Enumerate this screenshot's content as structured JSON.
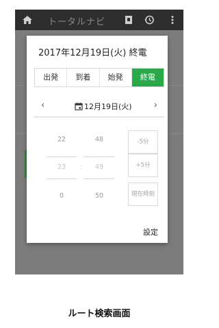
{
  "appbar": {
    "title": "トータルナビ"
  },
  "dialog": {
    "title": "2017年12月19日(火) 終電",
    "modes": [
      "出発",
      "到着",
      "始発",
      "終電"
    ],
    "active_mode": "終電",
    "date": "12月19日(火)",
    "prev": "‹",
    "next": "›",
    "hour_values": [
      "22",
      "23",
      "0"
    ],
    "minute_values": [
      "48",
      "49",
      "50"
    ],
    "separator": ":",
    "minus5": "-5分",
    "plus5": "+5分",
    "now": "現在時刻",
    "ok": "設定"
  },
  "caption": "ルート検索画面",
  "colors": {
    "accent": "#2aa84a",
    "appbar": "#2e2e2e"
  }
}
